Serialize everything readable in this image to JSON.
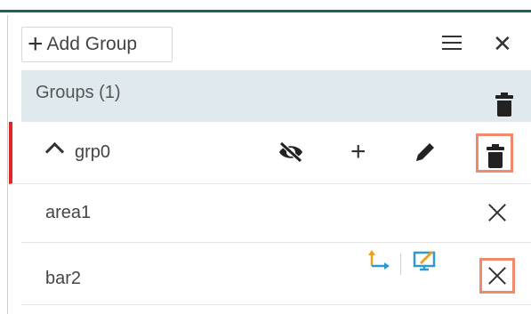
{
  "toolbar": {
    "add_group_label": "Add Group",
    "add_icon": "plus-icon",
    "menu_icon": "hamburger-menu-icon",
    "close_icon": "close-icon"
  },
  "groups_header": {
    "title": "Groups (1)",
    "delete_icon": "trash-icon"
  },
  "group": {
    "name": "grp0",
    "expanded": true,
    "accent_color": "#e0262d",
    "actions": [
      "hide-visibility-icon",
      "add-icon",
      "edit-pencil-icon",
      "trash-icon"
    ]
  },
  "items": [
    {
      "name": "area1",
      "actions": [
        "remove-icon"
      ]
    },
    {
      "name": "bar2",
      "actions": [
        "axis-icon",
        "monitor-edit-icon",
        "remove-icon"
      ]
    }
  ],
  "colors": {
    "header_bg": "#dfe9ee",
    "highlight": "#f08a6c",
    "top_bar": "#1f5d63",
    "axis_icon": "#f0a020",
    "monitor_icon": "#2a9ad0"
  }
}
